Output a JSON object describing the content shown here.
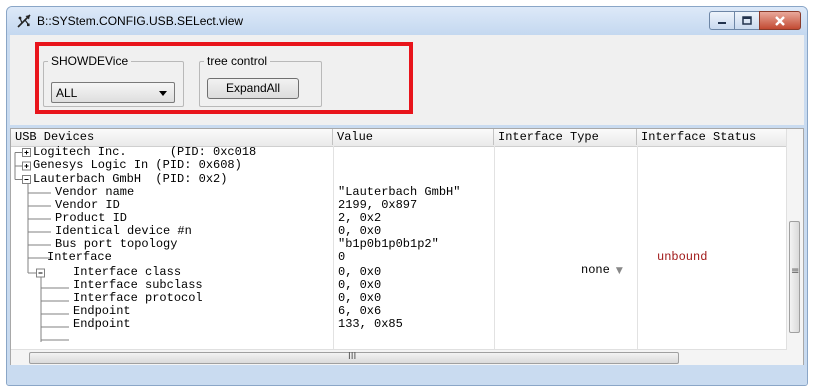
{
  "window": {
    "title": "B::SYStem.CONFIG.USB.SELect.view"
  },
  "toolbar": {
    "show_group_label": "SHOWDEVice",
    "show_value": "ALL",
    "tree_group_label": "tree control",
    "expand_label": "ExpandAll"
  },
  "table": {
    "headers": [
      "USB Devices",
      "Value",
      "Interface Type",
      "Interface Status"
    ],
    "rows": [
      {
        "name": "Logitech Inc.      (PID: 0xc018",
        "value": "",
        "type": "",
        "status": ""
      },
      {
        "name": "Genesys Logic In (PID: 0x608)",
        "value": "",
        "type": "",
        "status": ""
      },
      {
        "name": "Lauterbach GmbH  (PID: 0x2)",
        "value": "",
        "type": "",
        "status": ""
      },
      {
        "name": "Vendor name",
        "value": "\"Lauterbach GmbH\"",
        "type": "",
        "status": ""
      },
      {
        "name": "Vendor ID",
        "value": "2199, 0x897",
        "type": "",
        "status": ""
      },
      {
        "name": "Product ID",
        "value": "2, 0x2",
        "type": "",
        "status": ""
      },
      {
        "name": "Identical device #n",
        "value": "0, 0x0",
        "type": "",
        "status": ""
      },
      {
        "name": "Bus port topology",
        "value": "\"b1p0b1p0b1p2\"",
        "type": "",
        "status": ""
      },
      {
        "name": "Interface",
        "value": "0",
        "type": "none",
        "status": "unbound"
      },
      {
        "name": "Interface class",
        "value": "0, 0x0",
        "type": "",
        "status": ""
      },
      {
        "name": "Interface subclass",
        "value": "0, 0x0",
        "type": "",
        "status": ""
      },
      {
        "name": "Interface protocol",
        "value": "0, 0x0",
        "type": "",
        "status": ""
      },
      {
        "name": "Endpoint",
        "value": "6, 0x6",
        "type": "",
        "status": ""
      },
      {
        "name": "Endpoint",
        "value": "133, 0x85",
        "type": "",
        "status": ""
      }
    ]
  },
  "scrollbar": {
    "h_middle_glyph": "III",
    "v_middle_glyph": "≡"
  },
  "colors": {
    "status_unbound": "#a01818",
    "highlight_box": "#e8141b"
  }
}
